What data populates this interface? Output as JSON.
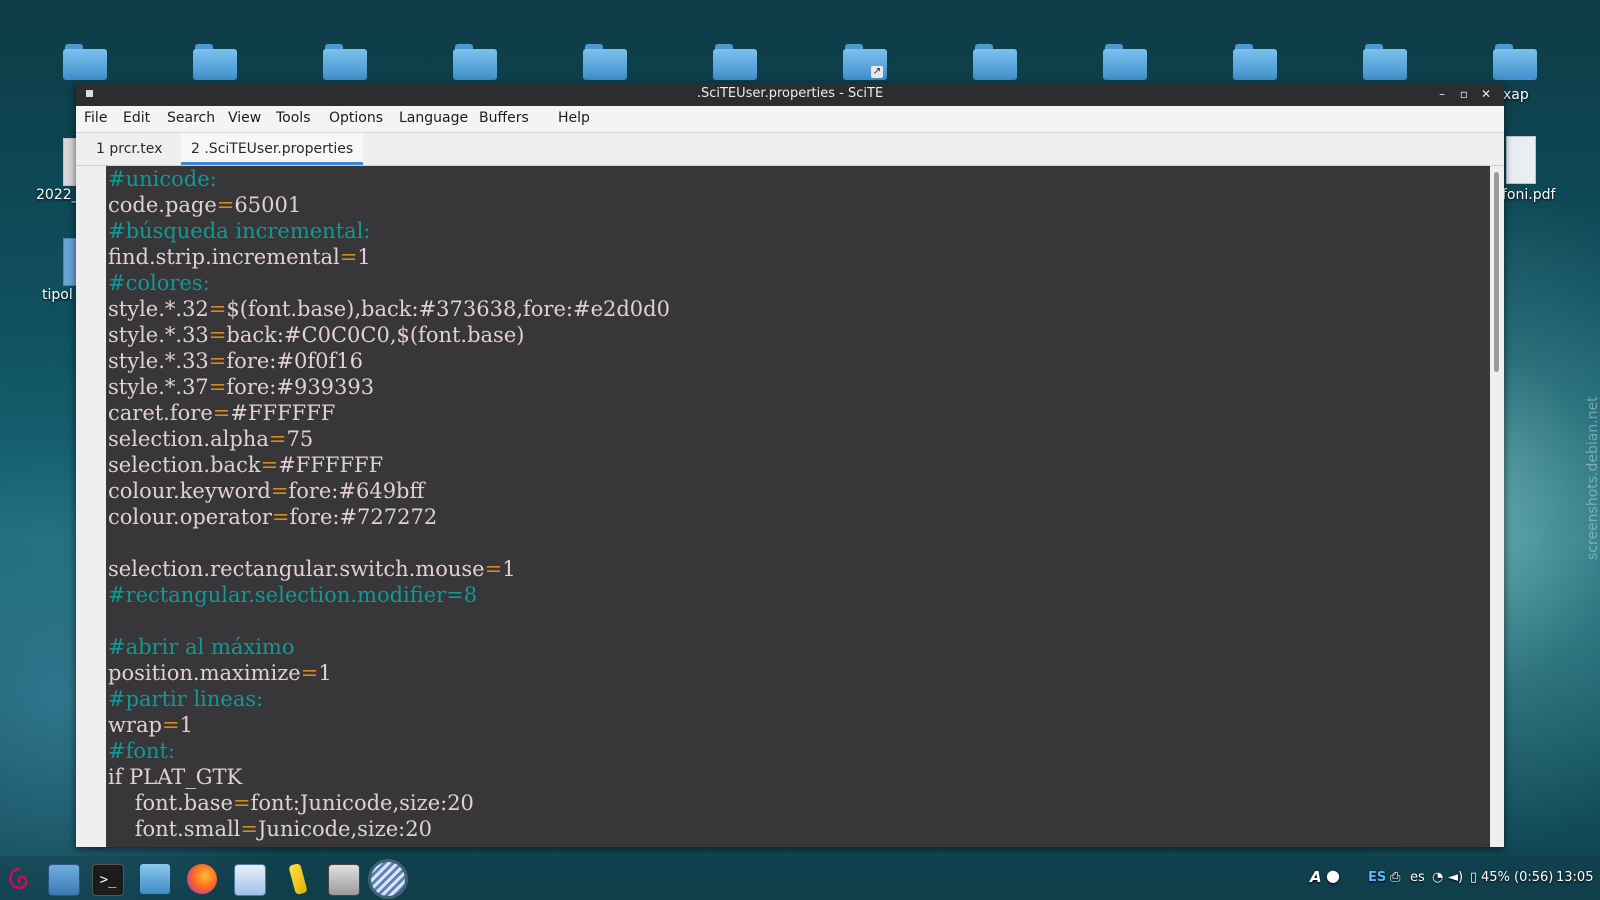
{
  "window": {
    "title": ".SciTEUser.properties - SciTE",
    "minimize_glyph": "–",
    "maximize_glyph": "▫",
    "close_glyph": "✕"
  },
  "menubar": [
    "File",
    "Edit",
    "Search",
    "View",
    "Tools",
    "Options",
    "Language",
    "Buffers",
    "Help"
  ],
  "tabs": [
    {
      "label": "1 prcr.tex",
      "active": false
    },
    {
      "label": "2 .SciTEUser.properties",
      "active": true
    }
  ],
  "editor": {
    "lines": [
      {
        "type": "comment",
        "text": "#unicode:"
      },
      {
        "type": "prop",
        "key": "code.page",
        "value": "65001"
      },
      {
        "type": "comment",
        "text": "#búsqueda incremental:"
      },
      {
        "type": "prop",
        "key": "find.strip.incremental",
        "value": "1"
      },
      {
        "type": "comment",
        "text": "#colores:"
      },
      {
        "type": "prop",
        "key": "style.*.32",
        "value": "$(font.base),back:#373638,fore:#e2d0d0"
      },
      {
        "type": "prop",
        "key": "style.*.33",
        "value": "back:#C0C0C0,$(font.base)"
      },
      {
        "type": "prop",
        "key": "style.*.33",
        "value": "fore:#0f0f16"
      },
      {
        "type": "prop",
        "key": "style.*.37",
        "value": "fore:#939393"
      },
      {
        "type": "prop",
        "key": "caret.fore",
        "value": "#FFFFFF"
      },
      {
        "type": "prop",
        "key": "selection.alpha",
        "value": "75"
      },
      {
        "type": "prop",
        "key": "selection.back",
        "value": "#FFFFFF"
      },
      {
        "type": "prop",
        "key": "colour.keyword",
        "value": "fore:#649bff"
      },
      {
        "type": "prop",
        "key": "colour.operator",
        "value": "fore:#727272"
      },
      {
        "type": "blank",
        "text": ""
      },
      {
        "type": "prop",
        "key": "selection.rectangular.switch.mouse",
        "value": "1"
      },
      {
        "type": "comment",
        "text": "#rectangular.selection.modifier=8"
      },
      {
        "type": "blank",
        "text": ""
      },
      {
        "type": "comment",
        "text": "#abrir al máximo"
      },
      {
        "type": "prop",
        "key": "position.maximize",
        "value": "1"
      },
      {
        "type": "comment",
        "text": "#partir lineas:"
      },
      {
        "type": "prop",
        "key": "wrap",
        "value": "1"
      },
      {
        "type": "comment",
        "text": "#font:"
      },
      {
        "type": "plain",
        "text": "if PLAT_GTK"
      },
      {
        "type": "prop",
        "key": "    font.base",
        "value": "font:Junicode,size:20"
      },
      {
        "type": "prop",
        "key": "    font.small",
        "value": "Junicode,size:20"
      }
    ],
    "colors": {
      "background": "#373638",
      "text": "#e2d0d0",
      "comment": "#0f9a96",
      "operator": "#d18b1e"
    }
  },
  "desktop": {
    "labels": {
      "left_1": "2022_",
      "left_2": "tipol",
      "right_top": "xap",
      "right_pdf": "foni.pdf"
    }
  },
  "taskbar": {
    "tray": {
      "input_icon": "A",
      "layout": "ES",
      "lang": "es",
      "battery": "45% (0:56)",
      "clock": "13:05"
    }
  },
  "icons": [
    "debian-menu-icon",
    "desktop-icon",
    "terminal-icon",
    "file-manager-icon",
    "firefox-icon",
    "document-viewer-icon",
    "text-editor-icon",
    "screenshot-icon",
    "scite-icon",
    "printer-icon",
    "wifi-icon",
    "volume-icon",
    "battery-icon"
  ]
}
